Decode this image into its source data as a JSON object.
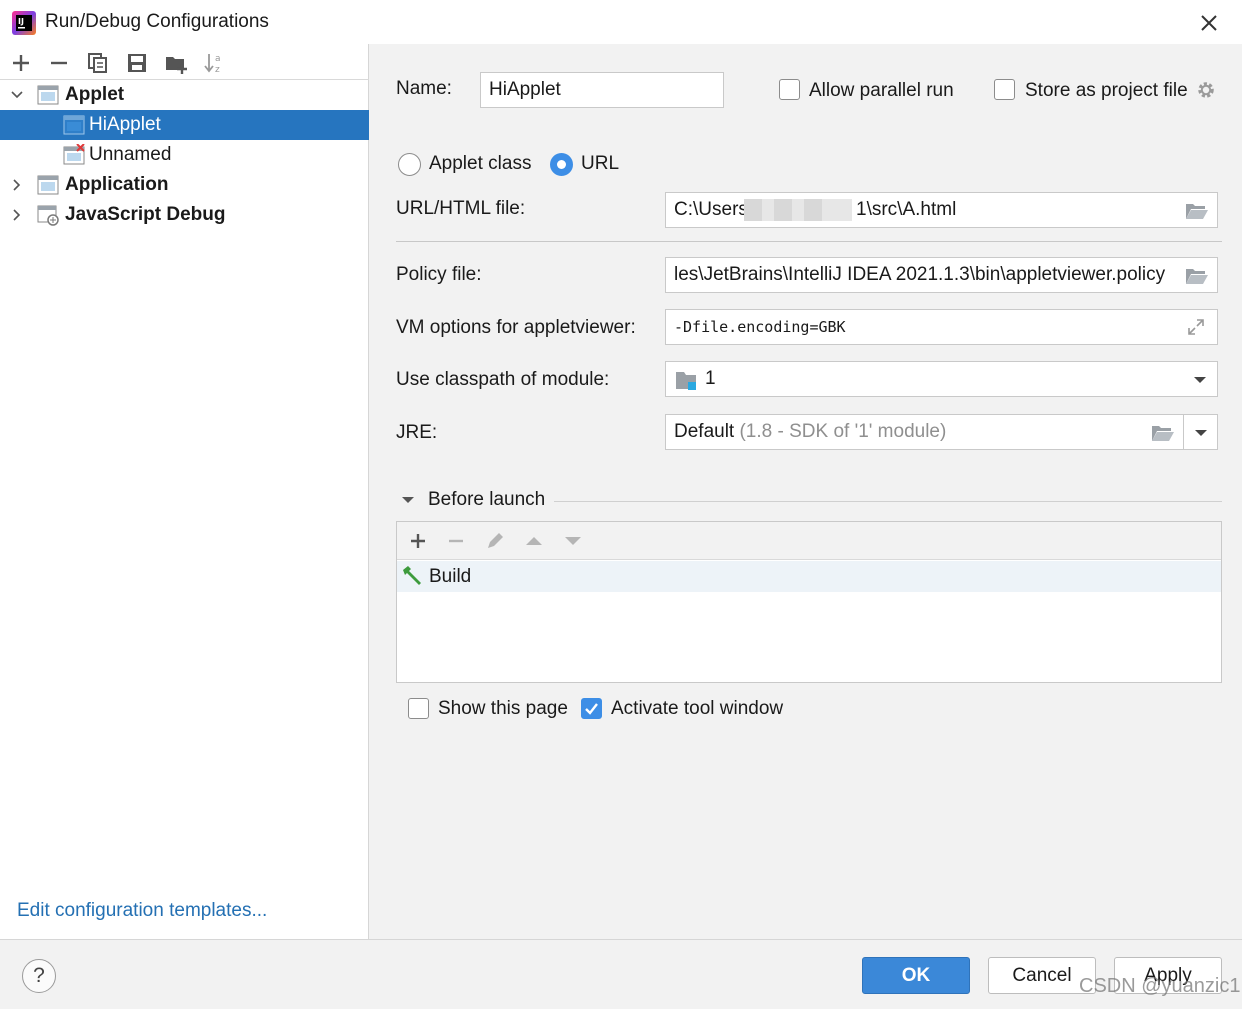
{
  "window": {
    "title": "Run/Debug Configurations"
  },
  "toolbar": {
    "icons": [
      "add-icon",
      "remove-icon",
      "copy-icon",
      "save-icon",
      "folder-add-icon",
      "sort-icon"
    ]
  },
  "tree": {
    "items": [
      {
        "label": "Applet",
        "bold": true,
        "expanded": true
      },
      {
        "label": "HiApplet",
        "selected": true
      },
      {
        "label": "Unnamed",
        "error": true
      },
      {
        "label": "Application",
        "bold": true,
        "expanded": false
      },
      {
        "label": "JavaScript Debug",
        "bold": true,
        "expanded": false
      }
    ]
  },
  "left_footer": {
    "edit_templates": "Edit configuration templates..."
  },
  "form": {
    "name_label": "Name:",
    "name_value": "HiApplet",
    "allow_parallel_label": "Allow parallel run",
    "allow_parallel_checked": false,
    "store_project_label": "Store as project file",
    "store_project_checked": false,
    "applet_class_label": "Applet class",
    "url_label": "URL",
    "selected_radio": "URL",
    "url_file_label": "URL/HTML file:",
    "url_file_prefix": "C:\\Users",
    "url_file_suffix": "1\\src\\A.html",
    "policy_label": "Policy file:",
    "policy_value": "les\\JetBrains\\IntelliJ IDEA 2021.1.3\\bin\\appletviewer.policy",
    "vm_label": "VM options for appletviewer:",
    "vm_value": "-Dfile.encoding=GBK",
    "classpath_label": "Use classpath of module:",
    "classpath_value": "1",
    "jre_label": "JRE:",
    "jre_value": "Default",
    "jre_hint": "(1.8 - SDK of '1' module)"
  },
  "before_launch": {
    "title": "Before launch",
    "tasks": [
      "Build"
    ]
  },
  "options": {
    "show_page_label": "Show this page",
    "show_page_checked": false,
    "activate_tool_label": "Activate tool window",
    "activate_tool_checked": true
  },
  "footer": {
    "help_label": "?",
    "ok_label": "OK",
    "cancel_label": "Cancel",
    "apply_label": "Apply"
  },
  "watermark": "CSDN @yuanzic1",
  "colors": {
    "selection": "#2675bf",
    "primary_button": "#3b88d8",
    "link": "#2470b3",
    "checkbox_checked": "#3d8ee6"
  }
}
